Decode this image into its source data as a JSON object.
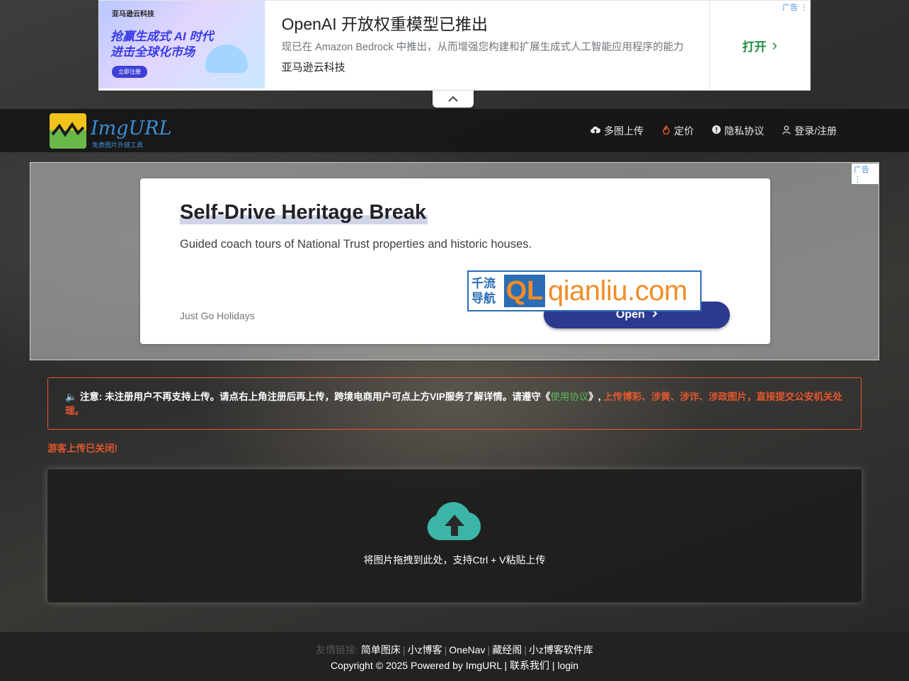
{
  "top_ad": {
    "image_brand": "亚马逊云科技",
    "image_slogan_1": "抢赢生成式 AI 时代",
    "image_slogan_2": "进击全球化市场",
    "image_button": "立即注册",
    "ad_tag": "广告",
    "title": "OpenAI 开放权重模型已推出",
    "description": "现已在 Amazon Bedrock 中推出，从而增强您构建和扩展生成式人工智能应用程序的能力",
    "advertiser": "亚马逊云科技",
    "open_label": "打开",
    "open_icon": "chevron-right-icon",
    "collapse_icon": "chevron-up-icon"
  },
  "header": {
    "logo_text": "ImgURL",
    "logo_subtitle": "免费图片外链工具",
    "nav": [
      {
        "label": "多图上传",
        "icon": "cloud-upload-icon"
      },
      {
        "label": "定价",
        "icon": "fire-icon"
      },
      {
        "label": "隐私协议",
        "icon": "info-icon"
      },
      {
        "label": "登录/注册",
        "icon": "user-icon"
      }
    ]
  },
  "middle_ad": {
    "ad_tag": "广告",
    "title": "Self-Drive Heritage Break",
    "description": "Guided coach tours of National Trust properties and historic houses.",
    "advertiser": "Just Go Holidays",
    "open_label": "Open",
    "watermark_cn_1": "千流",
    "watermark_cn_2": "导航",
    "watermark_ql": "QL",
    "watermark_url": "qianliu.com"
  },
  "notice": {
    "label": "注意:",
    "text": "未注册用户不再支持上传。请点右上角注册后再上传，跨境电商用户可点上方VIP服务了解详情。请遵守《",
    "agreement_link": "使用协议",
    "text_end": "》,",
    "warning": "上传博彩、涉黄、涉诈、涉政图片，直接提交公安机关处理。"
  },
  "guest_closed": "游客上传已关闭!",
  "upload": {
    "icon": "cloud-upload-icon",
    "hint": "将图片拖拽到此处，支持Ctrl + V粘贴上传"
  },
  "footer": {
    "friends_label": "友情链接:",
    "links": [
      "简单图床",
      "小z博客",
      "OneNav",
      "藏经阁",
      "小z博客软件库"
    ],
    "copyright": "Copyright © 2025 Powered by ImgURL | 联系我们 | login"
  },
  "colors": {
    "accent_green": "#1e8e3e",
    "ad_button_navy": "#2b3a8f",
    "warning_orange": "#e4572e",
    "link_green": "#5cb85c",
    "upload_teal": "#3bb5a8",
    "logo_blue": "#3a8fd8"
  }
}
